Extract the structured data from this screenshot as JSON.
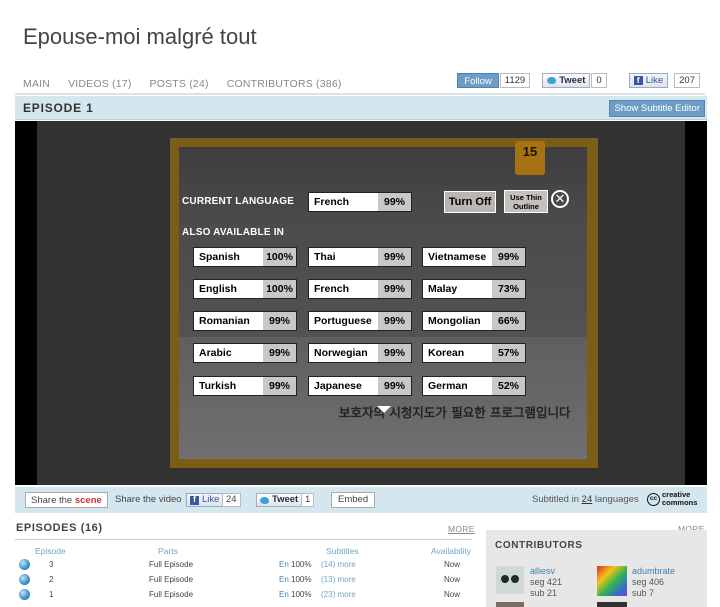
{
  "page": {
    "title": "Epouse-moi malgré tout"
  },
  "nav": [
    {
      "label": "MAIN"
    },
    {
      "label": "VIDEOS (17)"
    },
    {
      "label": "POSTS (24)"
    },
    {
      "label": "CONTRIBUTORS (386)"
    }
  ],
  "social": {
    "follow_label": "Follow",
    "follow_count": "1129",
    "tweet_label": "Tweet",
    "tweet_count": "0",
    "like_label": "Like",
    "like_count": "207"
  },
  "episode": {
    "title": "EPISODE 1",
    "subtitle_editor_label": "Show Subtitle Editor"
  },
  "poster": {
    "korean_text": "보호자의 시청지도가 필요한 프로그램입니다",
    "rating": "15"
  },
  "overlay": {
    "current_language_label": "CURRENT LANGUAGE",
    "also_available_label": "ALSO AVAILABLE IN",
    "current": {
      "name": "French",
      "pct": "99%"
    },
    "turn_off_label": "Turn Off",
    "thin_outline_line1": "Use Thin",
    "thin_outline_line2": "Outline",
    "close_symbol": "✕",
    "languages": [
      {
        "name": "Spanish",
        "pct": "100%"
      },
      {
        "name": "Thai",
        "pct": "99%"
      },
      {
        "name": "Vietnamese",
        "pct": "99%"
      },
      {
        "name": "English",
        "pct": "100%"
      },
      {
        "name": "French",
        "pct": "99%"
      },
      {
        "name": "Malay",
        "pct": "73%"
      },
      {
        "name": "Romanian",
        "pct": "99%"
      },
      {
        "name": "Portuguese",
        "pct": "99%"
      },
      {
        "name": "Mongolian",
        "pct": "66%"
      },
      {
        "name": "Arabic",
        "pct": "99%"
      },
      {
        "name": "Norwegian",
        "pct": "99%"
      },
      {
        "name": "Korean",
        "pct": "57%"
      },
      {
        "name": "Turkish",
        "pct": "99%"
      },
      {
        "name": "Japanese",
        "pct": "99%"
      },
      {
        "name": "German",
        "pct": "52%"
      }
    ]
  },
  "share": {
    "scene_prefix": "Share the ",
    "scene_word": "scene",
    "video_label": "Share the video",
    "like_label": "Like",
    "like_count": "24",
    "tweet_label": "Tweet",
    "tweet_count": "1",
    "embed_label": "Embed",
    "subtitled_prefix": "Subtitled in ",
    "subtitled_count": "24",
    "subtitled_suffix": " languages",
    "cc_symbol": "cc",
    "cc_line1": "creative",
    "cc_line2": "commons"
  },
  "episodes": {
    "title": "EPISODES (16)",
    "more_label": "MORE",
    "columns": [
      "Episode",
      "Parts",
      "Subtitles",
      "Availability"
    ],
    "rows": [
      {
        "num": "3",
        "parts": "Full Episode",
        "lang": "En",
        "pct": "100%",
        "more": "(14) more",
        "avail": "Now"
      },
      {
        "num": "2",
        "parts": "Full Episode",
        "lang": "En",
        "pct": "100%",
        "more": "(13) more",
        "avail": "Now"
      },
      {
        "num": "1",
        "parts": "Full Episode",
        "lang": "En",
        "pct": "100%",
        "more": "(23) more",
        "avail": "Now"
      }
    ]
  },
  "contributors": {
    "title": "CONTRIBUTORS",
    "more_label": "MORE",
    "people": [
      {
        "name": "alliesv",
        "seg": "seg 421",
        "sub": "sub 21"
      },
      {
        "name": "adumbrate",
        "seg": "seg 406",
        "sub": "sub 7"
      }
    ]
  }
}
